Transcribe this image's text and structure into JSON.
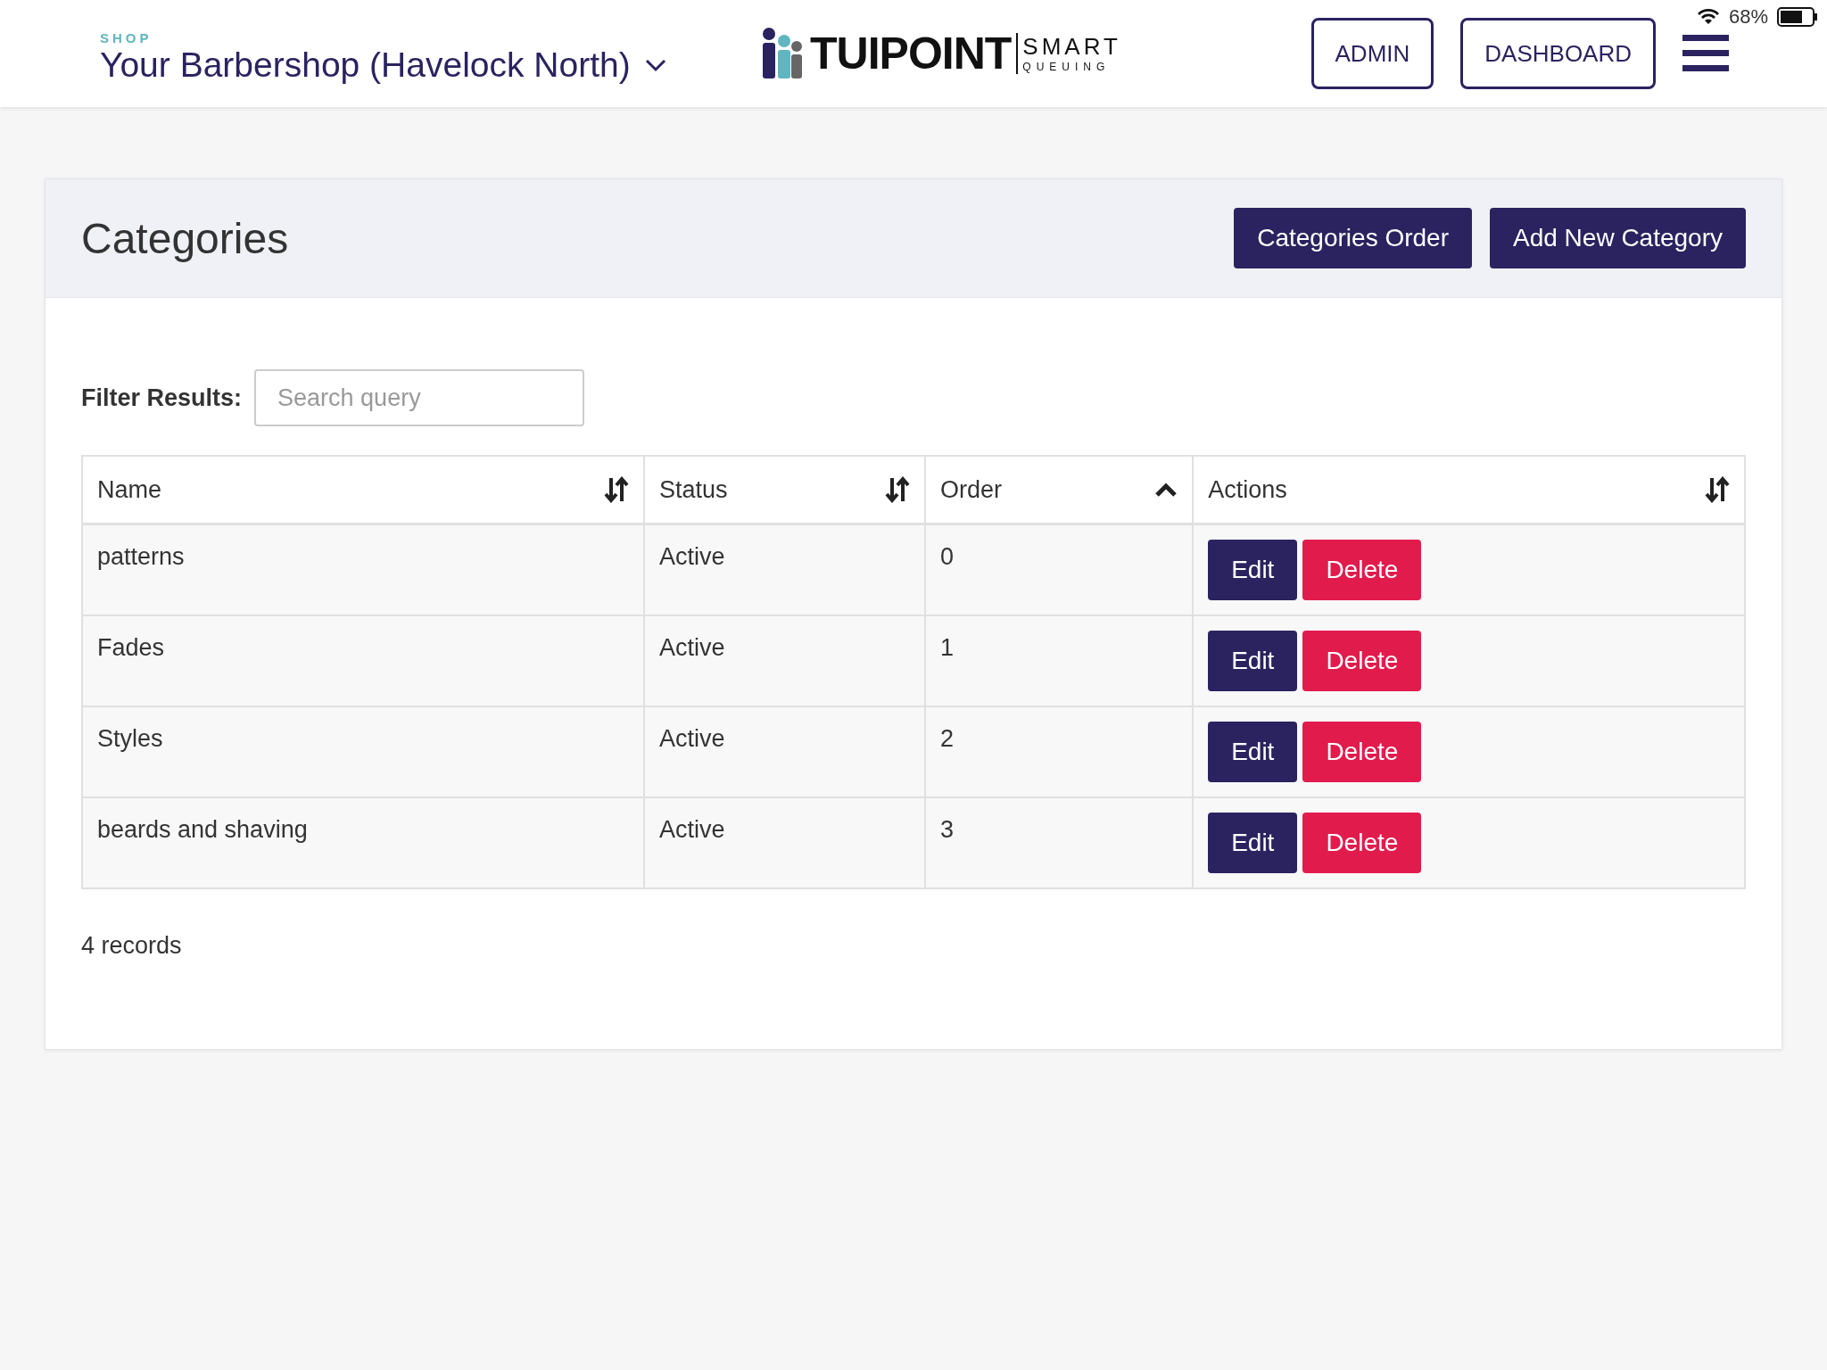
{
  "status_bar": {
    "battery": "68%"
  },
  "header": {
    "shop_label": "SHOP",
    "shop_name": "Your Barbershop (Havelock North)",
    "logo": {
      "main": "TUIPOINT",
      "top": "SMART",
      "bottom": "QUEUING"
    },
    "buttons": [
      "ADMIN",
      "DASHBOARD"
    ]
  },
  "card": {
    "title": "Categories",
    "buttons": [
      "Categories Order",
      "Add New Category"
    ],
    "filter": {
      "label": "Filter Results:",
      "placeholder": "Search query"
    },
    "table": {
      "columns": [
        {
          "label": "Name",
          "sorted": false
        },
        {
          "label": "Status",
          "sorted": false
        },
        {
          "label": "Order",
          "sorted": true
        },
        {
          "label": "Actions",
          "sorted": false
        }
      ],
      "rows": [
        {
          "name": "patterns",
          "status": "Active",
          "order": "0",
          "actions": [
            "Edit",
            "Delete"
          ]
        },
        {
          "name": "Fades",
          "status": "Active",
          "order": "1",
          "actions": [
            "Edit",
            "Delete"
          ]
        },
        {
          "name": "Styles",
          "status": "Active",
          "order": "2",
          "actions": [
            "Edit",
            "Delete"
          ]
        },
        {
          "name": "beards and shaving",
          "status": "Active",
          "order": "3",
          "actions": [
            "Edit",
            "Delete"
          ]
        }
      ]
    },
    "footer": "4 records"
  }
}
